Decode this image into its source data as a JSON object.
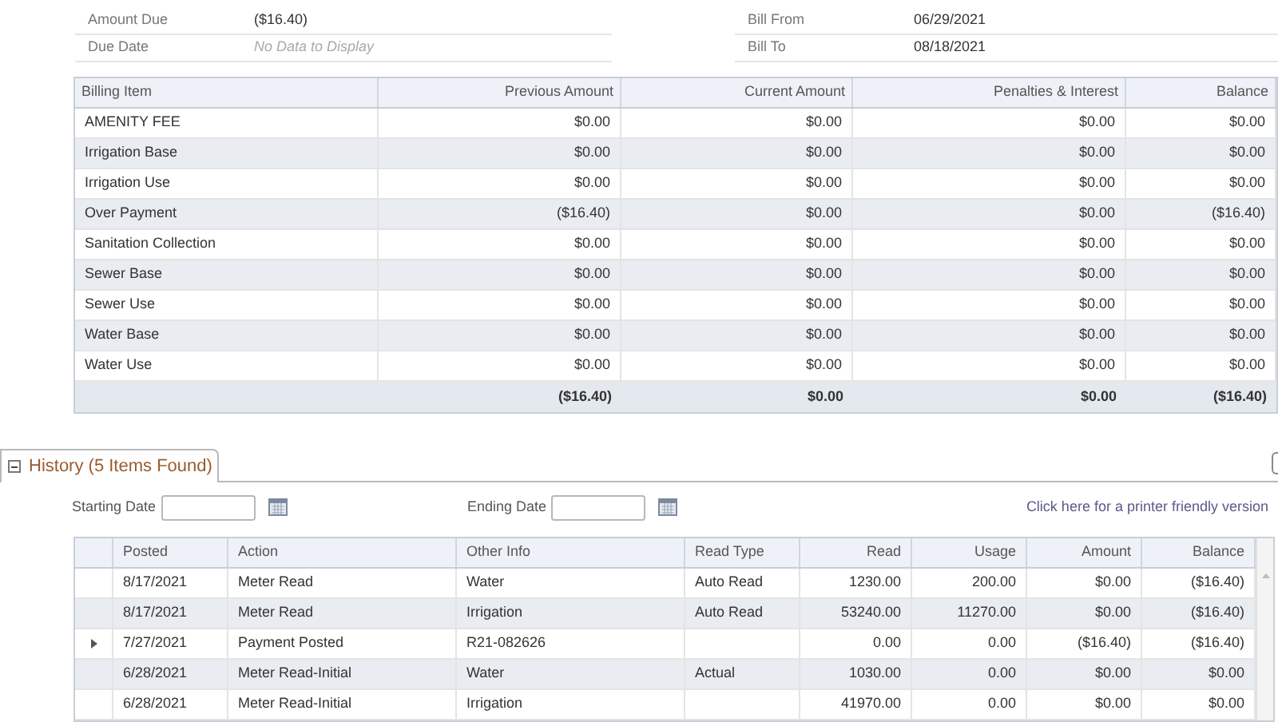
{
  "summary_left": [
    {
      "label": "Amount Due",
      "value": "($16.40)",
      "empty": false
    },
    {
      "label": "Due Date",
      "value": "No Data to Display",
      "empty": true
    }
  ],
  "summary_right": [
    {
      "label": "Bill From",
      "value": "06/29/2021",
      "empty": false
    },
    {
      "label": "Bill To",
      "value": "08/18/2021",
      "empty": false
    }
  ],
  "billing_table": {
    "columns": [
      "Billing Item",
      "Previous Amount",
      "Current Amount",
      "Penalties & Interest",
      "Balance"
    ],
    "rows": [
      [
        "AMENITY FEE",
        "$0.00",
        "$0.00",
        "$0.00",
        "$0.00"
      ],
      [
        "Irrigation Base",
        "$0.00",
        "$0.00",
        "$0.00",
        "$0.00"
      ],
      [
        "Irrigation Use",
        "$0.00",
        "$0.00",
        "$0.00",
        "$0.00"
      ],
      [
        "Over Payment",
        "($16.40)",
        "$0.00",
        "$0.00",
        "($16.40)"
      ],
      [
        "Sanitation Collection",
        "$0.00",
        "$0.00",
        "$0.00",
        "$0.00"
      ],
      [
        "Sewer Base",
        "$0.00",
        "$0.00",
        "$0.00",
        "$0.00"
      ],
      [
        "Sewer Use",
        "$0.00",
        "$0.00",
        "$0.00",
        "$0.00"
      ],
      [
        "Water Base",
        "$0.00",
        "$0.00",
        "$0.00",
        "$0.00"
      ],
      [
        "Water Use",
        "$0.00",
        "$0.00",
        "$0.00",
        "$0.00"
      ]
    ],
    "totals": [
      "($16.40)",
      "$0.00",
      "$0.00",
      "($16.40)"
    ]
  },
  "history": {
    "tab": {
      "label": "History (5 Items Found)",
      "expanded": true
    },
    "starting_date": {
      "label": "Starting Date"
    },
    "ending_date": {
      "label": "Ending Date"
    },
    "printer_link": "Click here for a printer friendly version",
    "columns": [
      "Posted",
      "Action",
      "Other Info",
      "Read Type",
      "Read",
      "Usage",
      "Amount",
      "Balance"
    ],
    "rows": [
      {
        "selected": false,
        "cells": [
          "8/17/2021",
          "Meter Read",
          "Water",
          "Auto Read",
          "1230.00",
          "200.00",
          "$0.00",
          "($16.40)"
        ]
      },
      {
        "selected": false,
        "cells": [
          "8/17/2021",
          "Meter Read",
          "Irrigation",
          "Auto Read",
          "53240.00",
          "11270.00",
          "$0.00",
          "($16.40)"
        ]
      },
      {
        "selected": true,
        "cells": [
          "7/27/2021",
          "Payment Posted",
          "R21-082626",
          "",
          "0.00",
          "0.00",
          "($16.40)",
          "($16.40)"
        ]
      },
      {
        "selected": false,
        "cells": [
          "6/28/2021",
          "Meter Read-Initial",
          "Water",
          "Actual",
          "1030.00",
          "0.00",
          "$0.00",
          "$0.00"
        ]
      },
      {
        "selected": false,
        "cells": [
          "6/28/2021",
          "Meter Read-Initial",
          "Irrigation",
          "",
          "41970.00",
          "0.00",
          "$0.00",
          "$0.00"
        ]
      }
    ]
  }
}
